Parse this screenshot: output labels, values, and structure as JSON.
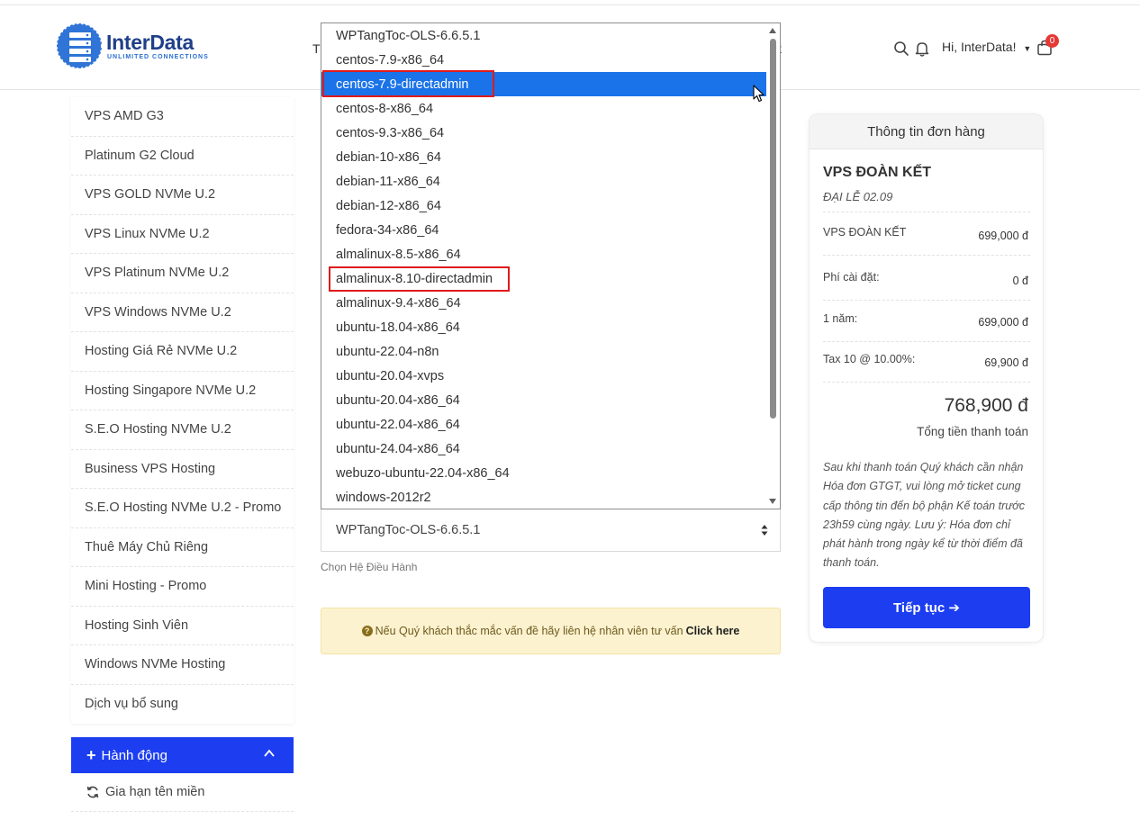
{
  "header": {
    "logo_text": "InterData",
    "logo_tagline": "UNLIMITED CONNECTIONS",
    "nav_partial_left": "T",
    "nav_partial_right": "t",
    "greeting": "Hi, InterData!",
    "cart_count": "0",
    "brand_color": "#1f3f8a"
  },
  "sidebar": {
    "items": [
      {
        "label": "VPS AMD G3"
      },
      {
        "label": "Platinum G2 Cloud"
      },
      {
        "label": "VPS GOLD NVMe U.2"
      },
      {
        "label": "VPS Linux NVMe U.2"
      },
      {
        "label": "VPS Platinum NVMe U.2"
      },
      {
        "label": "VPS Windows NVMe U.2"
      },
      {
        "label": "Hosting Giá Rẻ NVMe U.2"
      },
      {
        "label": "Hosting Singapore NVMe U.2"
      },
      {
        "label": "S.E.O Hosting NVMe U.2"
      },
      {
        "label": "Business VPS Hosting"
      },
      {
        "label": "S.E.O Hosting NVMe U.2 - Promo"
      },
      {
        "label": "Thuê Máy Chủ Riêng"
      },
      {
        "label": "Mini Hosting - Promo"
      },
      {
        "label": "Hosting Sinh Viên"
      },
      {
        "label": "Windows NVMe Hosting"
      },
      {
        "label": "Dịch vụ bổ sung"
      }
    ],
    "actions_title": "Hành động",
    "action_items": [
      {
        "label": "Gia hạn tên miền"
      }
    ],
    "accent_color": "#1d3ef0"
  },
  "os_dropdown": {
    "options": [
      {
        "label": "WPTangToc-OLS-6.6.5.1"
      },
      {
        "label": "centos-7.9-x86_64"
      },
      {
        "label": "centos-7.9-directadmin"
      },
      {
        "label": "centos-8-x86_64"
      },
      {
        "label": "centos-9.3-x86_64"
      },
      {
        "label": "debian-10-x86_64"
      },
      {
        "label": "debian-11-x86_64"
      },
      {
        "label": "debian-12-x86_64"
      },
      {
        "label": "fedora-34-x86_64"
      },
      {
        "label": "almalinux-8.5-x86_64"
      },
      {
        "label": "almalinux-8.10-directadmin"
      },
      {
        "label": "almalinux-9.4-x86_64"
      },
      {
        "label": "ubuntu-18.04-x86_64"
      },
      {
        "label": "ubuntu-22.04-n8n"
      },
      {
        "label": "ubuntu-20.04-xvps"
      },
      {
        "label": "ubuntu-20.04-x86_64"
      },
      {
        "label": "ubuntu-22.04-x86_64"
      },
      {
        "label": "ubuntu-24.04-x86_64"
      },
      {
        "label": "webuzo-ubuntu-22.04-x86_64"
      },
      {
        "label": "windows-2012r2"
      }
    ],
    "highlighted_option": "centos-7.9-directadmin",
    "annotated_options": [
      "centos-7.9-directadmin",
      "almalinux-8.10-directadmin"
    ],
    "selected_value": "WPTangToc-OLS-6.6.5.1",
    "help_text": "Chọn Hệ Điều Hành",
    "highlight_color": "#1a73e8",
    "annotation_color": "#e01b1b"
  },
  "notice": {
    "text": "Nếu Quý khách thắc mắc vấn đề hãy liên hệ nhân viên tư vấn",
    "link": "Click here",
    "bg_color": "#fcf2cf"
  },
  "order_summary": {
    "title": "Thông tin đơn hàng",
    "product_name": "VPS ĐOÀN KẾT",
    "promo": "ĐẠI LỄ 02.09",
    "rows": [
      {
        "label": "VPS ĐOÀN KẾT",
        "value": "699,000 đ"
      },
      {
        "label": "Phí cài đặt:",
        "value": "0 đ"
      },
      {
        "label": "1 năm:",
        "value": "699,000 đ"
      },
      {
        "label": "Tax 10 @ 10.00%:",
        "value": "69,900 đ"
      }
    ],
    "total": "768,900 đ",
    "total_label": "Tổng tiền thanh toán",
    "note": "Sau khi thanh toán Quý khách cần nhận Hóa đơn GTGT, vui lòng mở ticket cung cấp thông tin đến bộ phận Kế toán trước 23h59 cùng ngày. Lưu ý: Hóa đơn chỉ phát hành trong ngày kể từ thời điểm đã thanh toán.",
    "continue_label": "Tiếp tục ➔",
    "button_color": "#1d3ef0"
  }
}
